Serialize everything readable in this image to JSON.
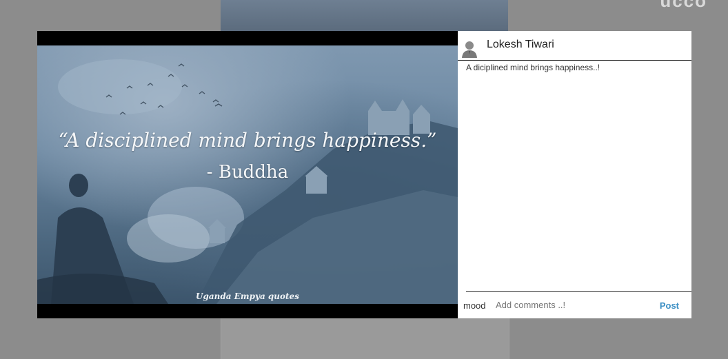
{
  "background": {
    "corner_text": "ucco"
  },
  "post": {
    "quote_text": "“A disciplined mind brings happiness.”",
    "quote_author": "- Buddha",
    "watermark": "Uganda Empya quotes"
  },
  "panel": {
    "username": "Lokesh Tiwari",
    "avatar_icon": "user-silhouette-icon",
    "caption": "A diciplined mind brings happiness..!",
    "mood_label": "mood",
    "comment_placeholder": "Add comments ..!",
    "post_label": "Post",
    "post_color": "#3b8fc4"
  }
}
